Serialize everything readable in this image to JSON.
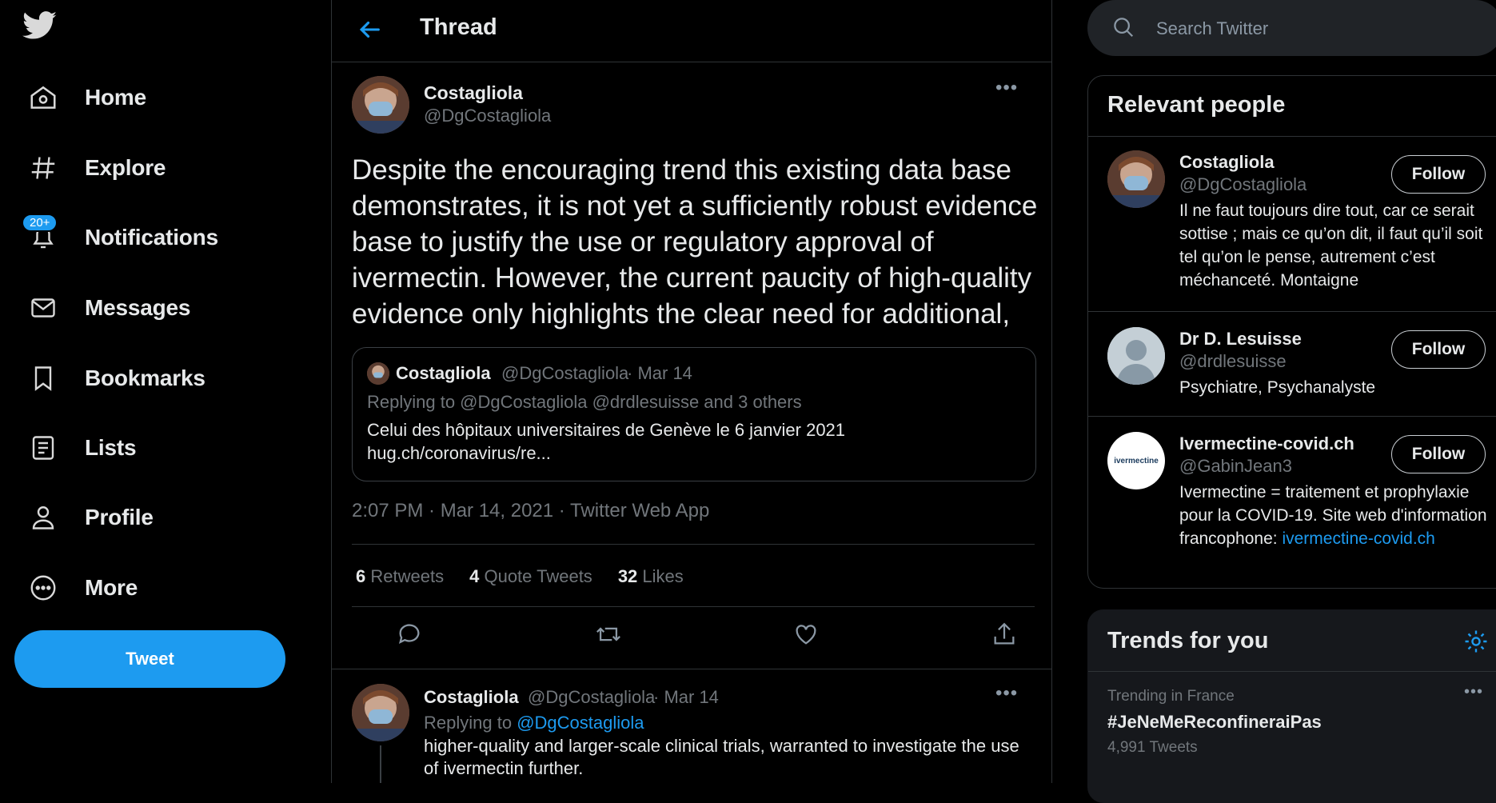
{
  "nav": {
    "items": [
      {
        "label": "Home",
        "icon": "home-icon"
      },
      {
        "label": "Explore",
        "icon": "hashtag-icon"
      },
      {
        "label": "Notifications",
        "icon": "bell-icon",
        "badge": "20+"
      },
      {
        "label": "Messages",
        "icon": "envelope-icon"
      },
      {
        "label": "Bookmarks",
        "icon": "bookmark-icon"
      },
      {
        "label": "Lists",
        "icon": "list-icon"
      },
      {
        "label": "Profile",
        "icon": "person-icon"
      },
      {
        "label": "More",
        "icon": "more-circle-icon"
      }
    ],
    "tweet_button": "Tweet"
  },
  "header": {
    "title": "Thread"
  },
  "tweet": {
    "name": "Costagliola",
    "handle": "@DgCostagliola",
    "text": "Despite the encouraging trend this existing data base demonstrates, it is not yet a sufficiently robust evidence base to justify the use or regulatory approval of ivermectin. However, the current paucity of high-quality evidence only highlights the clear need for additional,",
    "quote": {
      "name": "Costagliola",
      "handle": "@DgCostagliola",
      "date": "· Mar 14",
      "replying": "Replying to @DgCostagliola @drdlesuisse and 3 others",
      "text": "Celui des hôpitaux universitaires de Genève le 6 janvier 2021",
      "link": "hug.ch/coronavirus/re..."
    },
    "meta": "2:07 PM · Mar 14, 2021 · Twitter Web App",
    "stats": [
      {
        "count": "6",
        "label": "Retweets"
      },
      {
        "count": "4",
        "label": "Quote Tweets"
      },
      {
        "count": "32",
        "label": "Likes"
      }
    ]
  },
  "reply": {
    "name": "Costagliola",
    "handle": "@DgCostagliola",
    "date": "· Mar 14",
    "replying_prefix": "Replying to",
    "replying_to": "@DgCostagliola",
    "text": "higher-quality and larger-scale clinical trials, warranted to investigate the use of ivermectin further."
  },
  "search": {
    "placeholder": "Search Twitter"
  },
  "relevant": {
    "title": "Relevant people",
    "people": [
      {
        "name": "Costagliola",
        "handle": "@DgCostagliola",
        "follow": "Follow",
        "bio": "Il ne faut toujours dire tout, car ce serait sottise ; mais ce qu’on dit, il faut qu’il soit tel qu’on le pense, autrement c’est méchanceté. Montaigne"
      },
      {
        "name": "Dr D. Lesuisse",
        "handle": "@drdlesuisse",
        "follow": "Follow",
        "bio": "Psychiatre, Psychanalyste"
      },
      {
        "name": "Ivermectine-covid.ch",
        "handle": "@GabinJean3",
        "follow": "Follow",
        "bio": "Ivermectine = traitement et prophylaxie pour la COVID-19. Site web d'information francophone:",
        "bio_link": "ivermectine-covid.ch",
        "avatar_text": "ivermectine"
      }
    ]
  },
  "trends": {
    "title": "Trends for you",
    "items": [
      {
        "context": "Trending in France",
        "name": "#JeNeMeReconfineraiPas",
        "count": "4,991 Tweets"
      }
    ]
  },
  "colors": {
    "accent": "#1d9bf0",
    "background": "#000000",
    "border": "#2f3336",
    "muted": "#71767b"
  }
}
